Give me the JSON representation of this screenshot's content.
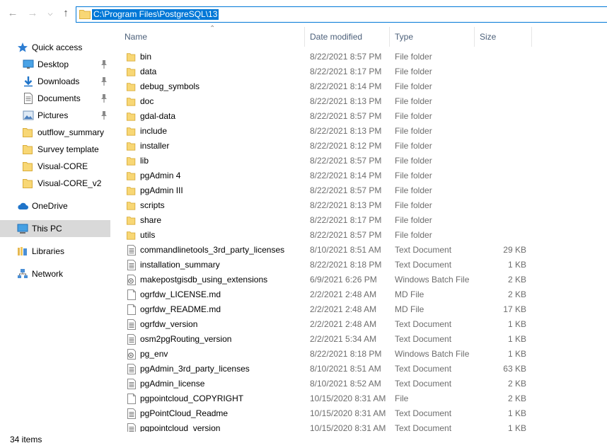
{
  "address": {
    "path": "C:\\Program Files\\PostgreSQL\\13"
  },
  "nav": {
    "items": [
      {
        "label": "Quick access",
        "icon": "star-icon",
        "kind": "header",
        "pinned": false
      },
      {
        "label": "Desktop",
        "icon": "desktop-icon",
        "kind": "sub",
        "pinned": true
      },
      {
        "label": "Downloads",
        "icon": "download-icon",
        "kind": "sub",
        "pinned": true
      },
      {
        "label": "Documents",
        "icon": "document-icon",
        "kind": "sub",
        "pinned": true
      },
      {
        "label": "Pictures",
        "icon": "pictures-icon",
        "kind": "sub",
        "pinned": true
      },
      {
        "label": "outflow_summary",
        "icon": "folder-icon",
        "kind": "sub",
        "pinned": false
      },
      {
        "label": "Survey template",
        "icon": "folder-icon",
        "kind": "sub",
        "pinned": false
      },
      {
        "label": "Visual-CORE",
        "icon": "folder-icon",
        "kind": "sub",
        "pinned": false
      },
      {
        "label": "Visual-CORE_v2",
        "icon": "folder-icon",
        "kind": "sub",
        "pinned": false
      },
      {
        "label": "OneDrive",
        "icon": "cloud-icon",
        "kind": "header",
        "pinned": false
      },
      {
        "label": "This PC",
        "icon": "computer-icon",
        "kind": "header",
        "pinned": false,
        "selected": true
      },
      {
        "label": "Libraries",
        "icon": "library-icon",
        "kind": "header",
        "pinned": false
      },
      {
        "label": "Network",
        "icon": "network-icon",
        "kind": "header",
        "pinned": false
      }
    ]
  },
  "columns": {
    "name": "Name",
    "date": "Date modified",
    "type": "Type",
    "size": "Size"
  },
  "files": [
    {
      "name": "bin",
      "date": "8/22/2021 8:57 PM",
      "type": "File folder",
      "size": "",
      "icon": "folder-icon"
    },
    {
      "name": "data",
      "date": "8/22/2021 8:17 PM",
      "type": "File folder",
      "size": "",
      "icon": "folder-icon"
    },
    {
      "name": "debug_symbols",
      "date": "8/22/2021 8:14 PM",
      "type": "File folder",
      "size": "",
      "icon": "folder-icon"
    },
    {
      "name": "doc",
      "date": "8/22/2021 8:13 PM",
      "type": "File folder",
      "size": "",
      "icon": "folder-icon"
    },
    {
      "name": "gdal-data",
      "date": "8/22/2021 8:57 PM",
      "type": "File folder",
      "size": "",
      "icon": "folder-icon"
    },
    {
      "name": "include",
      "date": "8/22/2021 8:13 PM",
      "type": "File folder",
      "size": "",
      "icon": "folder-icon"
    },
    {
      "name": "installer",
      "date": "8/22/2021 8:12 PM",
      "type": "File folder",
      "size": "",
      "icon": "folder-icon"
    },
    {
      "name": "lib",
      "date": "8/22/2021 8:57 PM",
      "type": "File folder",
      "size": "",
      "icon": "folder-icon"
    },
    {
      "name": "pgAdmin 4",
      "date": "8/22/2021 8:14 PM",
      "type": "File folder",
      "size": "",
      "icon": "folder-icon"
    },
    {
      "name": "pgAdmin III",
      "date": "8/22/2021 8:57 PM",
      "type": "File folder",
      "size": "",
      "icon": "folder-icon"
    },
    {
      "name": "scripts",
      "date": "8/22/2021 8:13 PM",
      "type": "File folder",
      "size": "",
      "icon": "folder-icon"
    },
    {
      "name": "share",
      "date": "8/22/2021 8:17 PM",
      "type": "File folder",
      "size": "",
      "icon": "folder-icon"
    },
    {
      "name": "utils",
      "date": "8/22/2021 8:57 PM",
      "type": "File folder",
      "size": "",
      "icon": "folder-icon"
    },
    {
      "name": "commandlinetools_3rd_party_licenses",
      "date": "8/10/2021 8:51 AM",
      "type": "Text Document",
      "size": "29 KB",
      "icon": "text-file-icon"
    },
    {
      "name": "installation_summary",
      "date": "8/22/2021 8:18 PM",
      "type": "Text Document",
      "size": "1 KB",
      "icon": "text-file-icon"
    },
    {
      "name": "makepostgisdb_using_extensions",
      "date": "6/9/2021 6:26 PM",
      "type": "Windows Batch File",
      "size": "2 KB",
      "icon": "batch-file-icon"
    },
    {
      "name": "ogrfdw_LICENSE.md",
      "date": "2/2/2021 2:48 AM",
      "type": "MD File",
      "size": "2 KB",
      "icon": "blank-file-icon"
    },
    {
      "name": "ogrfdw_README.md",
      "date": "2/2/2021 2:48 AM",
      "type": "MD File",
      "size": "17 KB",
      "icon": "blank-file-icon"
    },
    {
      "name": "ogrfdw_version",
      "date": "2/2/2021 2:48 AM",
      "type": "Text Document",
      "size": "1 KB",
      "icon": "text-file-icon"
    },
    {
      "name": "osm2pgRouting_version",
      "date": "2/2/2021 5:34 AM",
      "type": "Text Document",
      "size": "1 KB",
      "icon": "text-file-icon"
    },
    {
      "name": "pg_env",
      "date": "8/22/2021 8:18 PM",
      "type": "Windows Batch File",
      "size": "1 KB",
      "icon": "batch-file-icon"
    },
    {
      "name": "pgAdmin_3rd_party_licenses",
      "date": "8/10/2021 8:51 AM",
      "type": "Text Document",
      "size": "63 KB",
      "icon": "text-file-icon"
    },
    {
      "name": "pgAdmin_license",
      "date": "8/10/2021 8:52 AM",
      "type": "Text Document",
      "size": "2 KB",
      "icon": "text-file-icon"
    },
    {
      "name": "pgpointcloud_COPYRIGHT",
      "date": "10/15/2020 8:31 AM",
      "type": "File",
      "size": "2 KB",
      "icon": "blank-file-icon"
    },
    {
      "name": "pgPointCloud_Readme",
      "date": "10/15/2020 8:31 AM",
      "type": "Text Document",
      "size": "1 KB",
      "icon": "text-file-icon"
    },
    {
      "name": "pgpointcloud_version",
      "date": "10/15/2020 8:31 AM",
      "type": "Text Document",
      "size": "1 KB",
      "icon": "text-file-icon"
    }
  ],
  "status": {
    "item_count": "34 items"
  }
}
